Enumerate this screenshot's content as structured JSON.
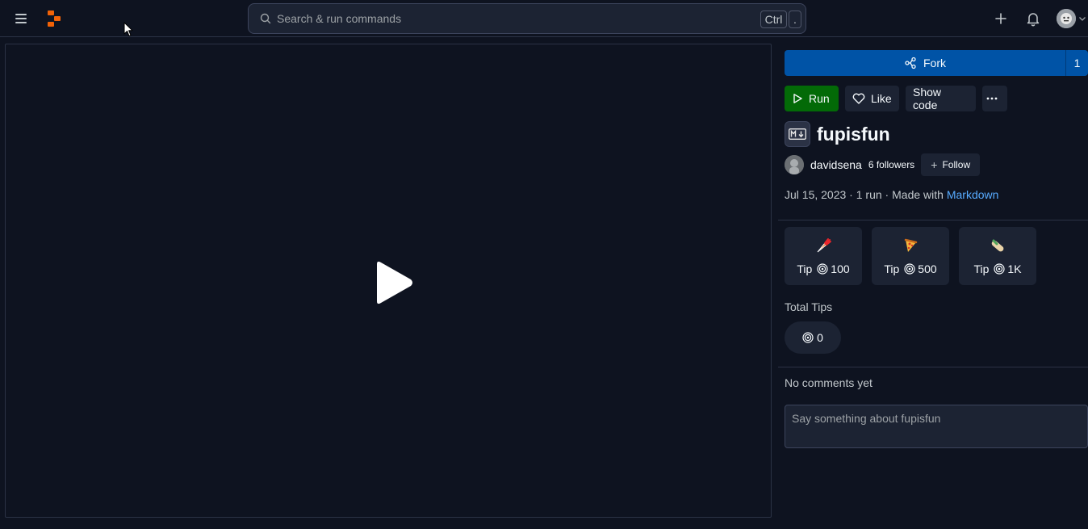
{
  "header": {
    "search_placeholder": "Search & run commands",
    "shortcut_ctrl": "Ctrl",
    "shortcut_key": "."
  },
  "actions": {
    "fork_label": "Fork",
    "fork_count": "1",
    "run_label": "Run",
    "like_label": "Like",
    "show_code_label": "Show code"
  },
  "repl": {
    "title": "fupisfun",
    "language_icon": "markdown-icon"
  },
  "author": {
    "name": "davidsena",
    "followers": "6 followers",
    "follow_label": "Follow"
  },
  "meta": {
    "date": "Jul 15, 2023",
    "sep1": " · ",
    "runs": "1 run",
    "sep2": " · ",
    "made_with_prefix": "Made with ",
    "made_with_link": "Markdown"
  },
  "tips": [
    {
      "icon": "carrot-emoji-icon",
      "label": "Tip",
      "amount": "100"
    },
    {
      "icon": "pizza-emoji-icon",
      "label": "Tip",
      "amount": "500"
    },
    {
      "icon": "burrito-emoji-icon",
      "label": "Tip",
      "amount": "1K"
    }
  ],
  "total_tips": {
    "label": "Total Tips",
    "value": "0"
  },
  "comments": {
    "empty_text": "No comments yet",
    "placeholder": "Say something about fupisfun"
  },
  "colors": {
    "background": "#0e1320",
    "surface": "#1c2333",
    "fork_blue": "#0053a6",
    "run_green": "#036a07",
    "link_blue": "#57abff",
    "logo_orange": "#f26207"
  }
}
